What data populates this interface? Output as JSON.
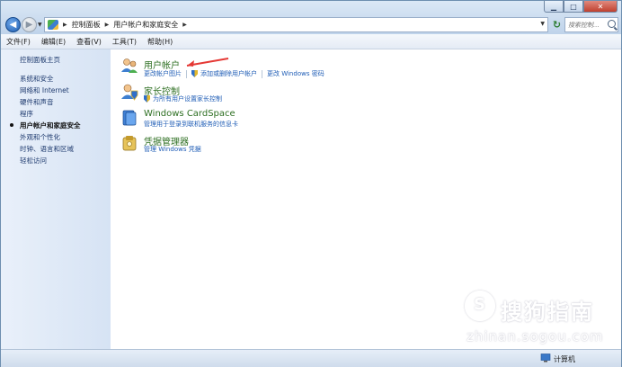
{
  "window": {
    "controls": {
      "minimize": "▁",
      "maximize": "□",
      "close": "✕"
    }
  },
  "navigation": {
    "breadcrumbs": [
      "控制面板",
      "用户帐户和家庭安全"
    ],
    "search_placeholder": "搜索控制..."
  },
  "menu": [
    "文件(F)",
    "编辑(E)",
    "查看(V)",
    "工具(T)",
    "帮助(H)"
  ],
  "sidebar": {
    "home": "控制面板主页",
    "items": [
      "系统和安全",
      "网络和 Internet",
      "硬件和声音",
      "程序",
      "用户帐户和家庭安全",
      "外观和个性化",
      "时钟、语言和区域",
      "轻松访问"
    ],
    "active_index": 4
  },
  "categories": [
    {
      "title": "用户帐户",
      "icon": "user-accounts-icon",
      "links": [
        {
          "text": "更改帐户图片",
          "shield": false
        },
        {
          "text": "添加或删除用户帐户",
          "shield": true
        },
        {
          "text": "更改 Windows 密码",
          "shield": false
        }
      ]
    },
    {
      "title": "家长控制",
      "icon": "parental-controls-icon",
      "links": [
        {
          "text": "为所有用户设置家长控制",
          "shield": true
        }
      ]
    },
    {
      "title": "Windows CardSpace",
      "icon": "cardspace-icon",
      "links": [
        {
          "text": "管理用于登录到联机服务的信息卡",
          "shield": false
        }
      ]
    },
    {
      "title": "凭据管理器",
      "icon": "credential-manager-icon",
      "links": [
        {
          "text": "管理 Windows 凭据",
          "shield": false
        }
      ]
    }
  ],
  "watermark": {
    "text": "搜狗指南",
    "url": "zhinan.sogou.com"
  },
  "status": {
    "text": "计算机"
  },
  "colors": {
    "link": "#1f5db6",
    "category_title": "#2e6f22",
    "sidebar_bg": "#dde8f6"
  }
}
